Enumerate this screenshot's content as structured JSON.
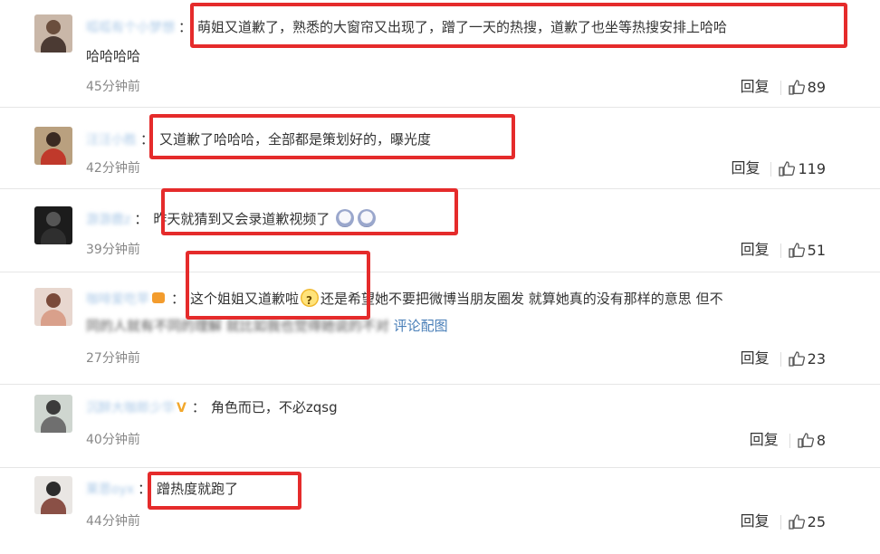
{
  "ui": {
    "reply_label": "回复",
    "highlight_color": "#e52b2b",
    "username_color": "#a8c7e6",
    "like_icon": "thumbs-up-icon",
    "colon": "："
  },
  "comments": [
    {
      "username": "呱呱有个小梦想",
      "text_line1": "萌姐又道歉了，熟悉的大窗帘又出现了，蹭了一天的热搜，道歉了也坐等热搜安排上哈哈",
      "text_line2": "哈哈哈哈",
      "time": "45分钟前",
      "likes": "89"
    },
    {
      "username": "汪汪小胜",
      "text_line1": "又道歉了哈哈哈，全部都是策划好的，曝光度",
      "time": "42分钟前",
      "likes": "119"
    },
    {
      "username": "游游鹿z",
      "text_line1": "昨天就猜到又会录道歉视频了",
      "time": "39分钟前",
      "likes": "51"
    },
    {
      "username": "咖啡爱吃苹",
      "text_line1_a": "这个姐姐又道歉啦",
      "text_line1_b": "还是希望她不要把微博当朋友圈发 就算她真的没有那样的意思 但不",
      "text_line2_a": "同的人就有不同的理解 就比如我也觉得她说的不对",
      "text_line2_link": "评论配图",
      "time": "27分钟前",
      "likes": "23"
    },
    {
      "username": "沉醉大咖郎少华",
      "badge": "V",
      "text_line1": "角色而已，不必zqsg",
      "time": "40分钟前",
      "likes": "8"
    },
    {
      "username": "莱恩oyx",
      "text_line1": "蹭热度就跑了",
      "time": "44分钟前",
      "likes": "25"
    }
  ]
}
